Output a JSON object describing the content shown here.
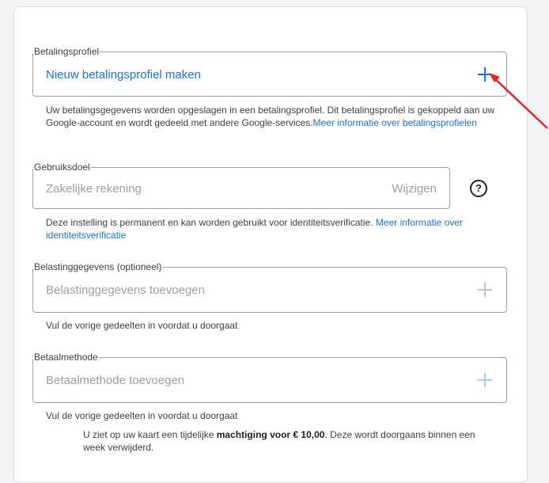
{
  "payment_profile": {
    "legend": "Betalingsprofiel",
    "value": "Nieuw betalingsprofiel maken",
    "help_text": "Uw betalingsgegevens worden opgeslagen in een betalingsprofiel. Dit betalingsprofiel is gekoppeld aan uw Google-account en wordt gedeeld met andere Google-services.",
    "help_link": "Meer informatie over betalingsprofielen"
  },
  "usage": {
    "legend": "Gebruiksdoel",
    "value": "Zakelijke rekening",
    "change_label": "Wijzigen",
    "help_text": "Deze instelling is permanent en kan worden gebruikt voor identiteitsverificatie.",
    "help_link": "Meer informatie over identiteitsverificatie"
  },
  "tax": {
    "legend": "Belastinggegevens (optioneel)",
    "value": "Belastinggegevens toevoegen",
    "help_text": "Vul de vorige gedeelten in voordat u doorgaat"
  },
  "payment_method": {
    "legend": "Betaalmethode",
    "value": "Betaalmethode toevoegen",
    "help_text": "Vul de vorige gedeelten in voordat u doorgaat"
  },
  "notice": {
    "text_before": "U ziet op uw kaart een tijdelijke ",
    "bold": "machtiging voor € 10,00",
    "text_after": ". Deze wordt doorgaans binnen een week verwijderd."
  },
  "colors": {
    "accent": "#1a73e8",
    "annotation_arrow": "#e8232a"
  }
}
